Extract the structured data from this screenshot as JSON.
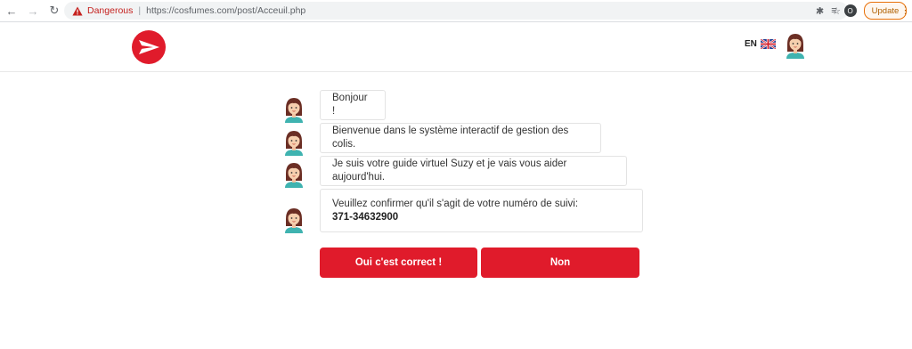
{
  "browser": {
    "security_label": "Dangerous",
    "url": "https://cosfumes.com/post/Acceuil.php",
    "profile_initial": "O",
    "update_label": "Update"
  },
  "header": {
    "lang_label": "EN"
  },
  "chat": {
    "messages": [
      "Bonjour !",
      "Bienvenue dans le système interactif de gestion des colis.",
      "Je suis votre guide virtuel Suzy et je vais vous aider aujourd'hui.",
      "Veuillez confirmer qu'il s'agit de votre numéro de suivi:"
    ],
    "tracking_number": "371-34632900"
  },
  "actions": {
    "confirm_label": "Oui c'est correct !",
    "deny_label": "Non"
  },
  "colors": {
    "brand_red": "#e01b2b",
    "danger": "#c5221f"
  }
}
